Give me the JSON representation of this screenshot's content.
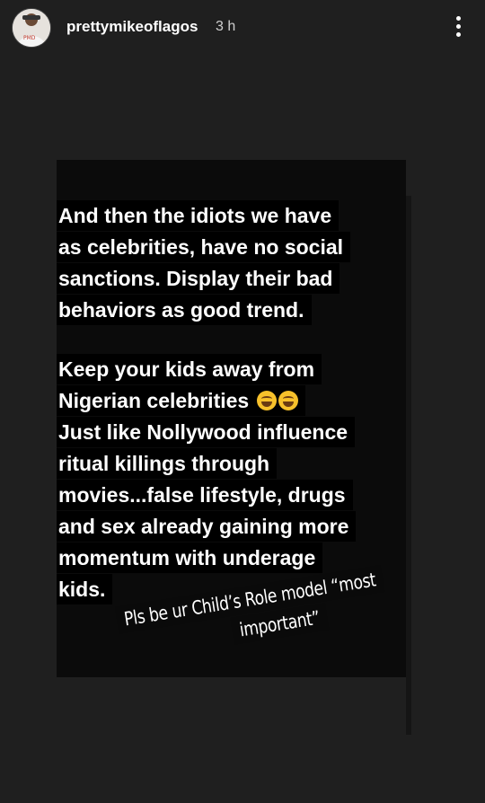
{
  "header": {
    "username": "prettymikeoflagos",
    "time": "3 h",
    "more_icon": "more-vertical-icon",
    "avatar_icon": "profile-avatar-icon"
  },
  "story": {
    "lines": [
      "And then the idiots we have",
      "as celebrities, have no social",
      "sanctions. Display their bad",
      "behaviors as good trend.",
      "Keep your kids away from",
      "Nigerian celebrities",
      "Just like Nollywood influence",
      "ritual killings through",
      "movies...false lifestyle, drugs",
      "and sex already gaining more",
      "momentum with underage",
      "kids."
    ],
    "emoji": "😂😂"
  },
  "sticker": {
    "line1": "Pls be ur Child’s Role model “most",
    "line2": "important”"
  },
  "colors": {
    "background": "#1f1f1f",
    "card": "#0b0b0b",
    "text": "#ffffff"
  }
}
